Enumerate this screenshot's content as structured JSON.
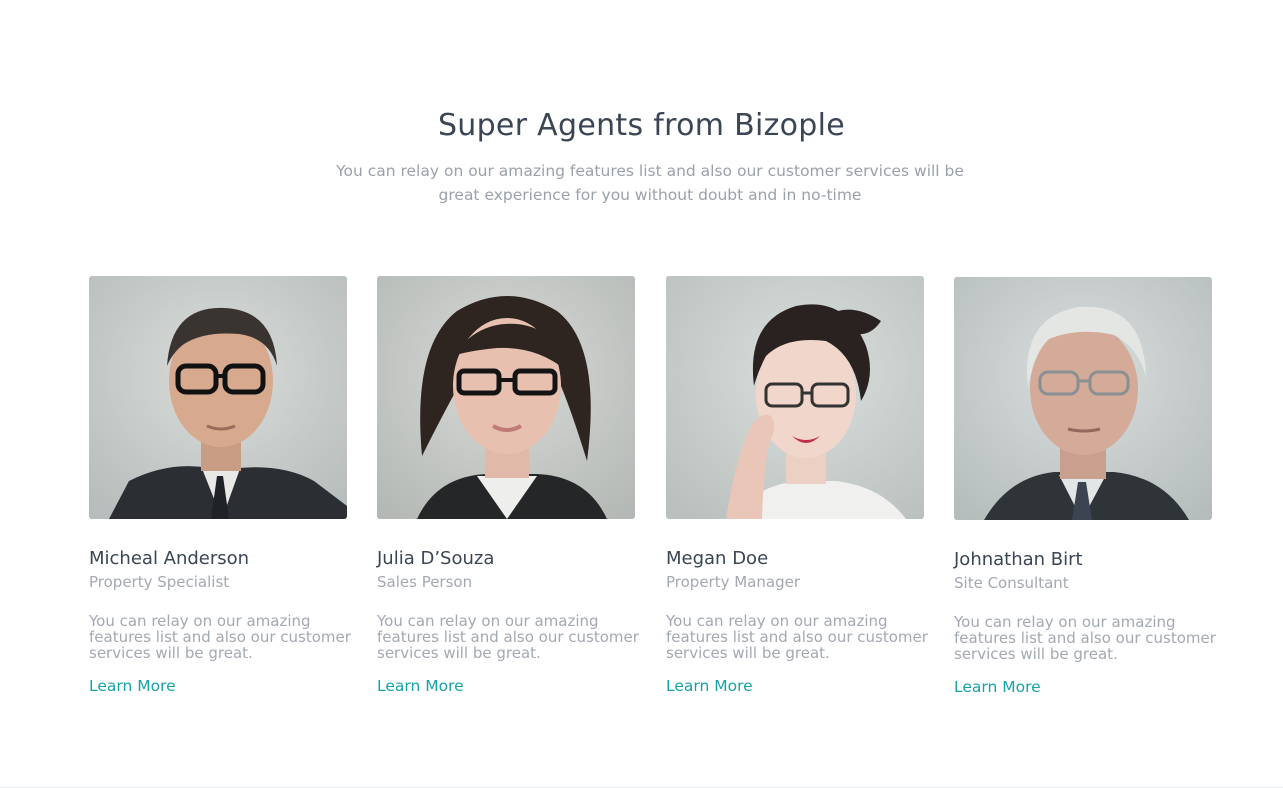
{
  "section": {
    "title": "Super Agents from Bizople",
    "subtitle": "You can relay on our amazing features list and also our customer services will be great experience for you without doubt and in no-time"
  },
  "agents": [
    {
      "name": "Micheal Anderson",
      "role": "Property Specialist",
      "description": "You can relay on our amazing features list and also our customer services will be great.",
      "link_label": "Learn More"
    },
    {
      "name": "Julia D’Souza",
      "role": "Sales Person",
      "description": "You can relay on our amazing features list and also our customer services will be great.",
      "link_label": "Learn More"
    },
    {
      "name": "Megan Doe",
      "role": "Property Manager",
      "description": "You can relay on our amazing features list and also our customer services will be great.",
      "link_label": "Learn More"
    },
    {
      "name": "Johnathan Birt",
      "role": "Site Consultant",
      "description": "You can relay on our amazing features list and also our customer services will be great.",
      "link_label": "Learn More"
    }
  ],
  "colors": {
    "accent": "#16a2ab",
    "heading": "#3a4555",
    "muted_text": "#a3a9b1"
  }
}
